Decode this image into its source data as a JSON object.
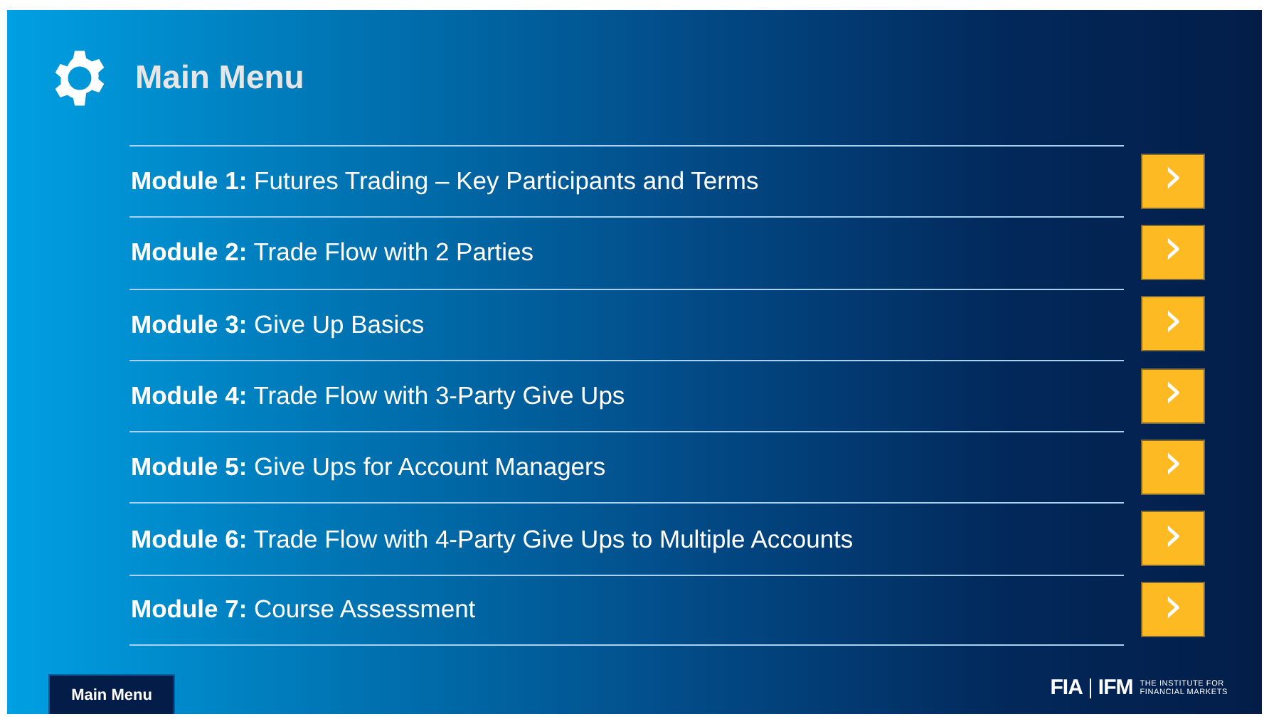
{
  "title": "Main Menu",
  "modules": [
    {
      "number": "Module 1:",
      "name": "Futures Trading – Key Participants and Terms",
      "arrow": "›"
    },
    {
      "number": "Module 2:",
      "name": "Trade Flow with 2 Parties",
      "arrow": "›"
    },
    {
      "number": "Module 3:",
      "name": "Give Up Basics",
      "arrow": "›"
    },
    {
      "number": "Module 4:",
      "name": "Trade Flow with 3-Party Give Ups",
      "arrow": "›"
    },
    {
      "number": "Module 5:",
      "name": "Give Ups for Account Managers",
      "arrow": "›"
    },
    {
      "number": "Module 6:",
      "name": "Trade Flow with 4-Party Give Ups to Multiple Accounts",
      "arrow": "›"
    },
    {
      "number": "Module 7:",
      "name": "Course Assessment",
      "arrow": "›"
    }
  ],
  "footer": {
    "button": "Main Menu",
    "logo": {
      "left": "FIA",
      "right": "IFM",
      "tagline": [
        "THE INSTITUTE FOR",
        "FINANCIAL MARKETS"
      ]
    }
  }
}
